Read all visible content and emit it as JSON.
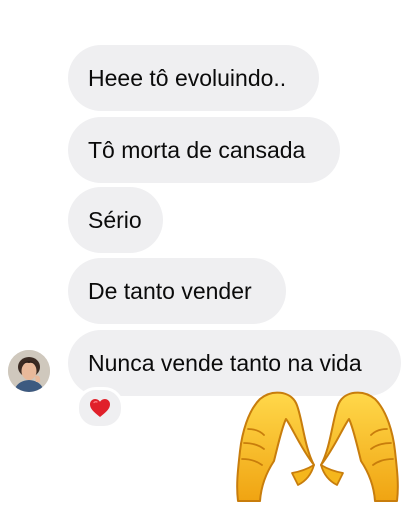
{
  "messages": [
    {
      "text": "Heee tô evoluindo.."
    },
    {
      "text": "Tô morta de cansada"
    },
    {
      "text": "Sério"
    },
    {
      "text": "De tanto vender"
    },
    {
      "text": "Nunca vende tanto na vida"
    }
  ],
  "reaction": {
    "icon": "red-heart-icon",
    "color": "#e0202a"
  },
  "sticker": {
    "icon": "heart-hands-emoji",
    "color": "#f5b61c"
  },
  "colors": {
    "bubble_background": "#efeff1",
    "text": "#0b0b0b"
  }
}
